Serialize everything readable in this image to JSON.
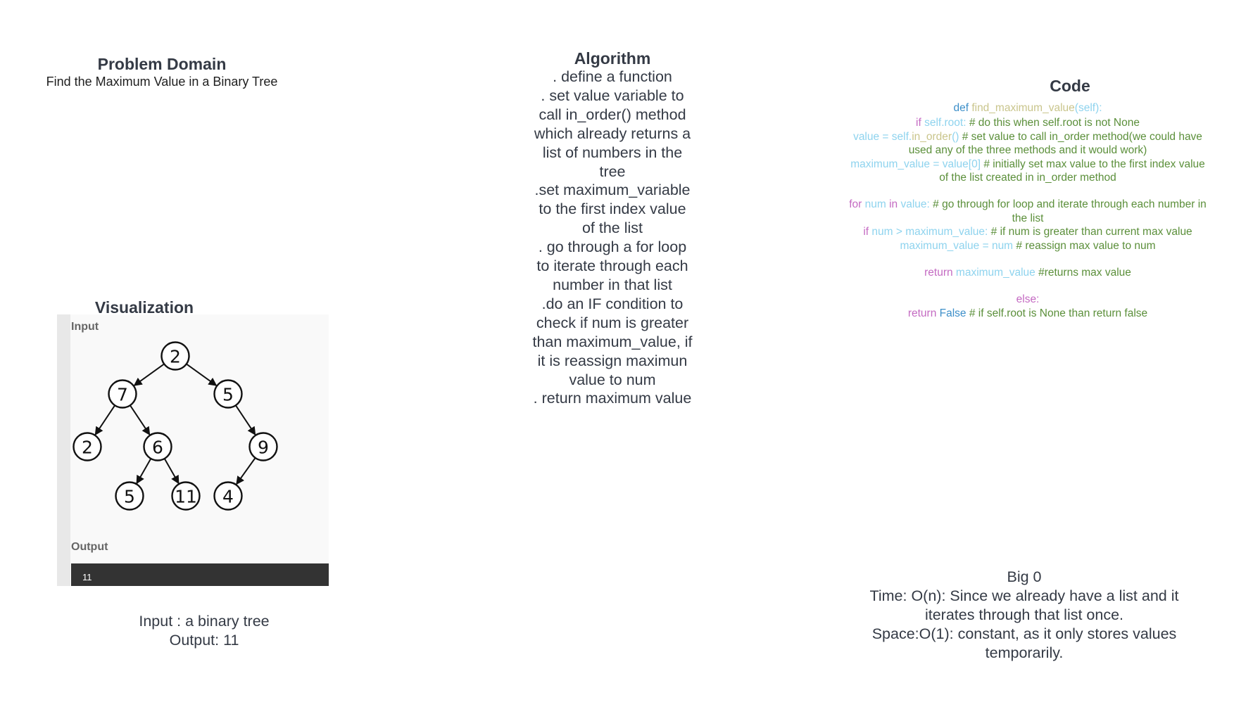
{
  "problem_domain": {
    "title": "Problem Domain",
    "subtitle": "Find the Maximum Value in a Binary Tree"
  },
  "algorithm": {
    "title": "Algorithm",
    "steps": [
      ". define a function",
      ". set value variable to",
      "call in_order() method",
      "which already returns a",
      "list of numbers in the",
      "tree",
      ".set maximum_variable",
      "to the first index value",
      "of the list",
      ". go through a for loop",
      "to iterate through each",
      "number in that list",
      ".do an IF condition to",
      "check if num is greater",
      "than maximum_value, if",
      "it is reassign maximun",
      "value to num",
      ". return maximum value"
    ]
  },
  "code": {
    "title": "Code",
    "lines": [
      [
        {
          "t": "def ",
          "c": "kw2"
        },
        {
          "t": "find_maximum_value",
          "c": "fn"
        },
        {
          "t": "(self):",
          "c": "var"
        }
      ],
      "gap-small",
      [
        {
          "t": "if ",
          "c": "kw"
        },
        {
          "t": "self.root: ",
          "c": "var"
        },
        {
          "t": "# do this when self.root is not None",
          "c": "cm"
        }
      ],
      [
        {
          "t": "value = self.",
          "c": "var"
        },
        {
          "t": "in_order",
          "c": "fn"
        },
        {
          "t": "() ",
          "c": "var"
        },
        {
          "t": "# set value to call in_order method(we could have",
          "c": "cm"
        }
      ],
      [
        {
          "t": "used any of the three methods and it would work)",
          "c": "cm"
        }
      ],
      [
        {
          "t": "maximum_value = value[0] ",
          "c": "var"
        },
        {
          "t": "# initially set max value to the first index value",
          "c": "cm"
        }
      ],
      [
        {
          "t": "of the list created in in_order method",
          "c": "cm"
        }
      ],
      "gap",
      [
        {
          "t": "for ",
          "c": "kw"
        },
        {
          "t": "num ",
          "c": "var"
        },
        {
          "t": "in ",
          "c": "kw"
        },
        {
          "t": "value: ",
          "c": "var"
        },
        {
          "t": "# go through for loop and iterate through each number in",
          "c": "cm"
        }
      ],
      [
        {
          "t": "the list",
          "c": "cm"
        }
      ],
      [
        {
          "t": "if ",
          "c": "kw"
        },
        {
          "t": "num > maximum_value: ",
          "c": "var"
        },
        {
          "t": "# if num is greater than current max value",
          "c": "cm"
        }
      ],
      [
        {
          "t": "maximum_value = num ",
          "c": "var"
        },
        {
          "t": "# reassign max value to num",
          "c": "cm"
        }
      ],
      "gap",
      [
        {
          "t": "return ",
          "c": "kw"
        },
        {
          "t": "maximum_value ",
          "c": "var"
        },
        {
          "t": "#returns max value",
          "c": "cm"
        }
      ],
      "gap",
      [
        {
          "t": "else:",
          "c": "kw"
        }
      ],
      [
        {
          "t": "return ",
          "c": "kw"
        },
        {
          "t": "False ",
          "c": "kw2"
        },
        {
          "t": "# if self.root is None than return false",
          "c": "cm"
        }
      ]
    ]
  },
  "visualization": {
    "title": "Visualization",
    "input_label": "Input",
    "output_label": "Output",
    "output_value": "11",
    "tree_nodes": [
      "2",
      "7",
      "5",
      "2",
      "6",
      "9",
      "5",
      "11",
      "4"
    ]
  },
  "io": {
    "input": "Input : a binary tree",
    "output": "Output: 11"
  },
  "big_o": {
    "title": "Big 0",
    "lines": [
      "Time: O(n): Since we already have a list and it",
      "iterates through that list once.",
      "Space:O(1): constant, as it only stores values",
      "temporarily."
    ]
  },
  "colors": {
    "heading": "#343a45",
    "code_keyword": "#c46ac2",
    "code_keyword_blue": "#3d8fc9",
    "code_function": "#c9c58c",
    "code_variable": "#8ed3ee",
    "code_comment": "#5b8f3a",
    "output_bar": "#333333"
  }
}
